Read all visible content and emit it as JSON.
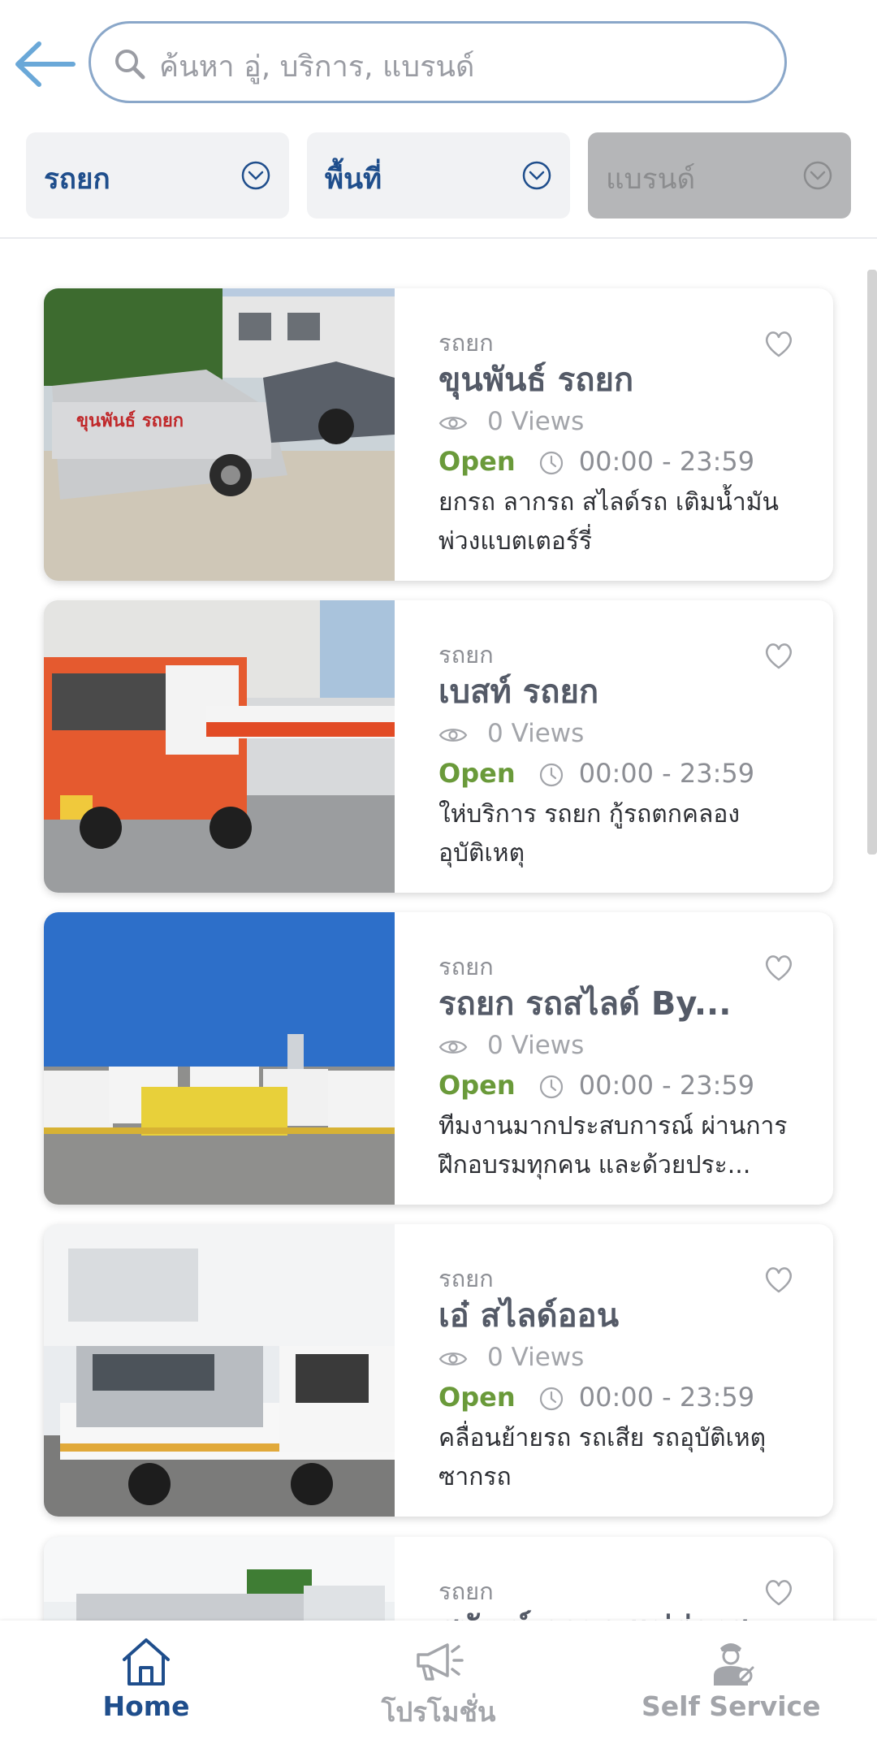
{
  "header": {
    "search_placeholder": "ค้นหา อู่, บริการ, แบรนด์",
    "filters": [
      {
        "label": "รถยก"
      },
      {
        "label": "พื้นที่"
      },
      {
        "label": "แบรนด์"
      }
    ]
  },
  "listings": [
    {
      "category": "รถยก",
      "title": "ขุนพันธ์ รถยก",
      "views": "0 Views",
      "status": "Open",
      "hours": "00:00 - 23:59",
      "description": "ยกรถ ลากรถ สไลด์รถ เติมน้ำมัน พ่วงแบตเตอร์รี่"
    },
    {
      "category": "รถยก",
      "title": "เบสท์ รถยก",
      "views": "0 Views",
      "status": "Open",
      "hours": "00:00 - 23:59",
      "description": "ให่บริการ รถยก กู้รถตกคลอง อุบัติเหตุ"
    },
    {
      "category": "รถยก",
      "title": "รถยก รถสไลด์ By...",
      "views": "0 Views",
      "status": "Open",
      "hours": "00:00 - 23:59",
      "description": "ทีมงานมากประสบการณ์ ผ่านการฝึกอบรมทุกคน และด้วยประ..."
    },
    {
      "category": "รถยก",
      "title": "เอ๋ สไลด์ออน",
      "views": "0 Views",
      "status": "Open",
      "hours": "00:00 - 23:59",
      "description": "คลื่อนย้ายรถ รถเสีย รถอุบัติเหตุ ซากรถ"
    },
    {
      "category": "รถยก",
      "title": "สุพัฒน์ รถยก แม่ฮ่องสอน",
      "views": "",
      "status": "",
      "hours": "",
      "description": ""
    }
  ],
  "bottom_nav": {
    "items": [
      {
        "label": "Home",
        "icon": "home-icon",
        "active": true
      },
      {
        "label": "โปรโมชั่น",
        "icon": "megaphone-icon",
        "active": false
      },
      {
        "label": "Self Service",
        "icon": "mechanic-icon",
        "active": false
      }
    ]
  },
  "colors": {
    "primary": "#1f4e8c",
    "open_green": "#6a9a3a",
    "search_border": "#8aa7c9",
    "filter_bg": "#f1f2f4",
    "filter_disabled_bg": "#b5b6b8"
  }
}
